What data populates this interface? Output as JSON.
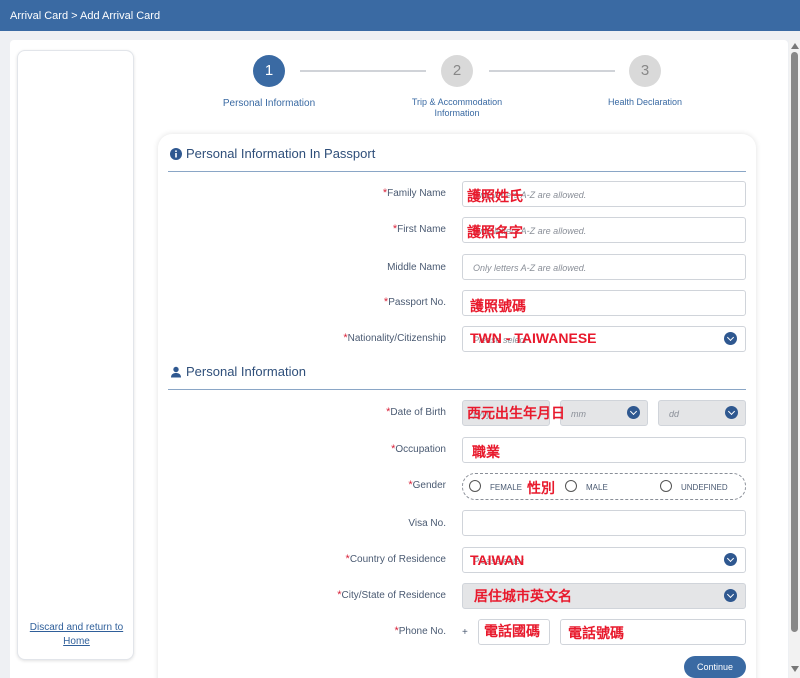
{
  "breadcrumb": "Arrival Card > Add Arrival Card",
  "sidebar": {
    "discard_link": "Discard and return to Home"
  },
  "steps": [
    {
      "number": "1",
      "label": "Personal Information"
    },
    {
      "number": "2",
      "label": "Trip & Accommodation Information"
    },
    {
      "number": "3",
      "label": "Health Declaration"
    }
  ],
  "passport_section": {
    "title": "Personal Information In Passport",
    "family_name": {
      "label": "Family Name",
      "placeholder": "Only letters A-Z are allowed.",
      "overlay": "護照姓氏"
    },
    "first_name": {
      "label": "First Name",
      "placeholder": "Only letters A-Z are allowed.",
      "overlay": "護照名字"
    },
    "middle_name": {
      "label": "Middle Name",
      "placeholder": "Only letters A-Z are allowed."
    },
    "passport_no": {
      "label": "Passport No.",
      "overlay": "護照號碼"
    },
    "nationality": {
      "label": "Nationality/Citizenship",
      "placeholder": "Please select",
      "overlay": "TWN - TAIWANESE"
    }
  },
  "personal_section": {
    "title": "Personal Information",
    "dob": {
      "label": "Date of Birth",
      "yyyy": "yyyy",
      "mm": "mm",
      "dd": "dd",
      "overlay": "西元出生年月日"
    },
    "occupation": {
      "label": "Occupation",
      "overlay": "職業"
    },
    "gender": {
      "label": "Gender",
      "options": [
        "FEMALE",
        "MALE",
        "UNDEFINED"
      ],
      "overlay": "性別"
    },
    "visa_no": {
      "label": "Visa No."
    },
    "country_residence": {
      "label": "Country of Residence",
      "placeholder": "Please enter",
      "overlay": "TAIWAN"
    },
    "city_residence": {
      "label": "City/State of Residence",
      "overlay": "居住城市英文名"
    },
    "phone": {
      "label": "Phone No.",
      "prefix": "+",
      "overlay_code": "電話國碼",
      "overlay_number": "電話號碼"
    }
  },
  "actions": {
    "continue": "Continue"
  },
  "colors": {
    "brand": "#3a6aa3",
    "required": "#d9233b",
    "overlay_text": "#e8192c"
  },
  "icons": {
    "passport_section": "info-icon",
    "personal_section": "person-icon",
    "dropdown": "chevron-down-icon"
  }
}
